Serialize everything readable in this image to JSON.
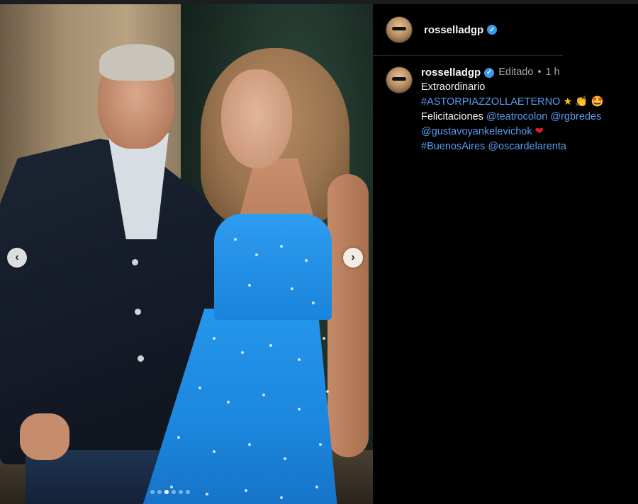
{
  "post": {
    "username": "rosselladgp",
    "verified": true,
    "carousel": {
      "slide_count": 6,
      "active_index": 2
    }
  },
  "caption": {
    "username": "rosselladgp",
    "edited": "Editado",
    "separator": "•",
    "time": "1 h",
    "line1": "Extraordinario",
    "hashtag1": "#ASTORPIAZZOLLAETERNO",
    "emoji_star": "★",
    "emoji_clap": "👏",
    "emoji_face": "🤩",
    "felicitaciones": "Felicitaciones",
    "mention1": "@teatrocolon",
    "mention2": "@rgbredes",
    "mention3": "@gustavoyankelevichok",
    "emoji_heart": "❤",
    "hashtag2": "#BuenosAires",
    "mention4": "@oscardelarenta"
  },
  "icons": {
    "prev": "‹",
    "next": "›",
    "verified": "✓"
  },
  "colors": {
    "link": "#5b9bf0",
    "verified": "#3897f0",
    "background": "#000000",
    "dress": "#2596ec"
  }
}
